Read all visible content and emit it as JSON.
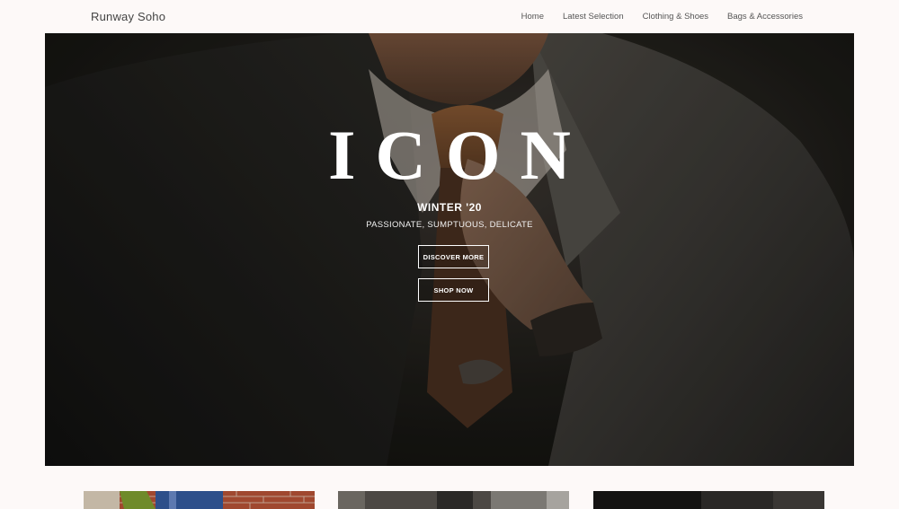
{
  "header": {
    "brand": "Runway Soho",
    "nav": [
      {
        "label": "Home"
      },
      {
        "label": "Latest Selection"
      },
      {
        "label": "Clothing & Shoes"
      },
      {
        "label": "Bags & Accessories"
      }
    ]
  },
  "hero": {
    "title": "ICON",
    "season": "WINTER '20",
    "tagline": "PASSIONATE, SUMPTUOUS, DELICATE",
    "discover_label": "DISCOVER MORE",
    "shop_label": "SHOP NOW"
  },
  "colors": {
    "page_background": "#fdf9f8",
    "hero_text": "#ffffff",
    "nav_text": "#555555"
  },
  "cards": [
    {
      "image": "brick-wall-model-photo"
    },
    {
      "image": "interior-photo"
    },
    {
      "image": "dark-photo"
    }
  ]
}
